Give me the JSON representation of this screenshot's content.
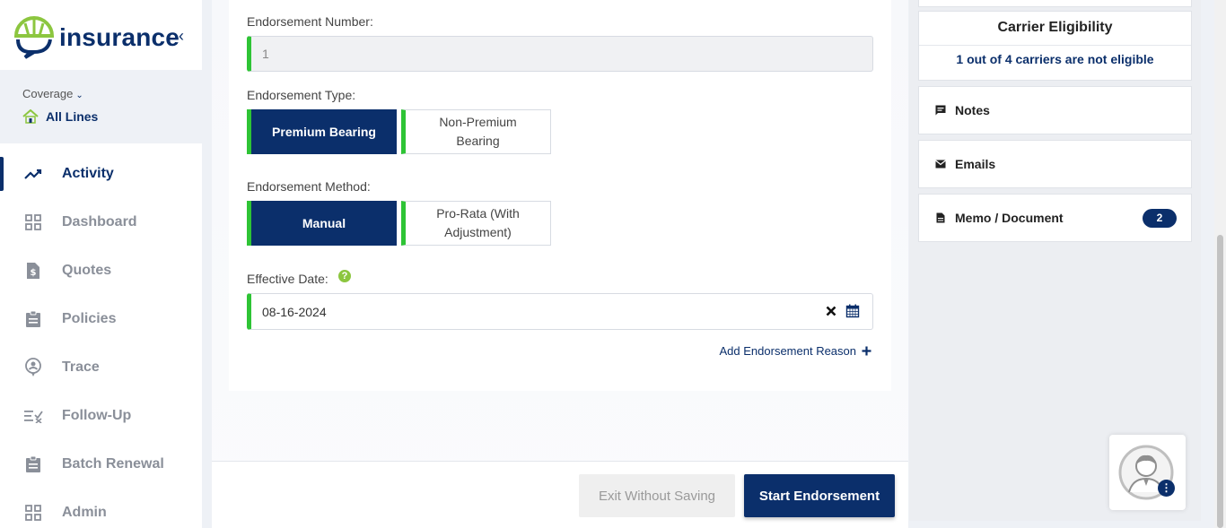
{
  "app": {
    "logo_text": "insurance",
    "collapse_icon": "chevron-left-icon"
  },
  "coverage": {
    "label": "Coverage",
    "value": "All Lines"
  },
  "nav": [
    {
      "label": "Activity",
      "icon": "activity-trend-icon",
      "active": true
    },
    {
      "label": "Dashboard",
      "icon": "dashboard-grid-icon"
    },
    {
      "label": "Quotes",
      "icon": "quotes-file-icon"
    },
    {
      "label": "Policies",
      "icon": "policies-clipboard-icon"
    },
    {
      "label": "Trace",
      "icon": "trace-pin-icon"
    },
    {
      "label": "Follow-Up",
      "icon": "follow-up-list-icon"
    },
    {
      "label": "Batch Renewal",
      "icon": "batch-clipboard-icon"
    },
    {
      "label": "Admin",
      "icon": "admin-grid-icon"
    }
  ],
  "form": {
    "endorsement_number_label": "Endorsement Number:",
    "endorsement_number_value": "1",
    "endorsement_type_label": "Endorsement Type:",
    "type_options": [
      "Premium Bearing",
      "Non-Premium Bearing"
    ],
    "type_selected": "Premium Bearing",
    "endorsement_method_label": "Endorsement Method:",
    "method_options": [
      "Manual",
      "Pro-Rata (With Adjustment)"
    ],
    "method_selected": "Manual",
    "effective_date_label": "Effective Date:",
    "effective_date_value": "08-16-2024",
    "help_glyph": "?",
    "add_reason_label": "Add Endorsement Reason"
  },
  "footer": {
    "exit_label": "Exit Without Saving",
    "start_label": "Start Endorsement"
  },
  "right": {
    "carrier_title": "Carrier Eligibility",
    "carrier_message": "1 out of 4 carriers are not eligible",
    "notes_label": "Notes",
    "emails_label": "Emails",
    "memo_label": "Memo / Document",
    "memo_count": "2"
  },
  "colors": {
    "primary": "#0b2f6b",
    "accent_green": "#2ec435",
    "help_green": "#8cc63f"
  }
}
